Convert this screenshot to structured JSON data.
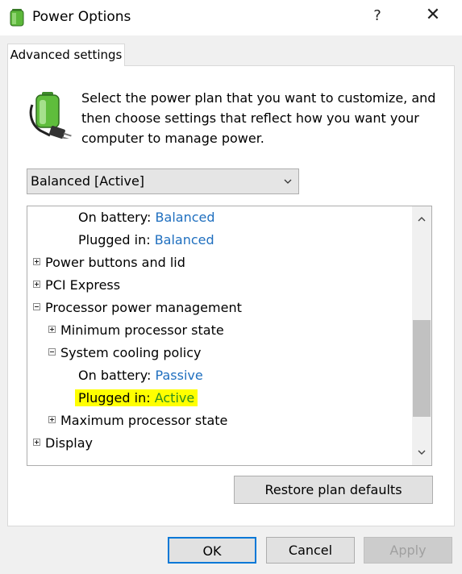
{
  "window": {
    "title": "Power Options",
    "help_label": "?",
    "close_label": "✕"
  },
  "tab": {
    "label": "Advanced settings"
  },
  "description": "Select the power plan that you want to customize, and then choose settings that reflect how you want your computer to manage power.",
  "plan_select": {
    "value": "Balanced [Active]"
  },
  "tree": {
    "items": [
      {
        "label": "On battery:",
        "value": "Balanced"
      },
      {
        "label": "Plugged in:",
        "value": "Balanced"
      },
      {
        "label": "Power buttons and lid"
      },
      {
        "label": "PCI Express"
      },
      {
        "label": "Processor power management"
      },
      {
        "label": "Minimum processor state"
      },
      {
        "label": "System cooling policy"
      },
      {
        "label": "On battery:",
        "value": "Passive"
      },
      {
        "label": "Plugged in:",
        "value": "Active"
      },
      {
        "label": "Maximum processor state"
      },
      {
        "label": "Display"
      }
    ],
    "scroll_fraction": 0.58
  },
  "buttons": {
    "restore": "Restore plan defaults",
    "ok": "OK",
    "cancel": "Cancel",
    "apply": "Apply"
  },
  "colors": {
    "value_link": "#1f6fbf",
    "highlight": "#ffff00",
    "highlight_text": "#2f8f1f",
    "focus_border": "#0078d7"
  }
}
